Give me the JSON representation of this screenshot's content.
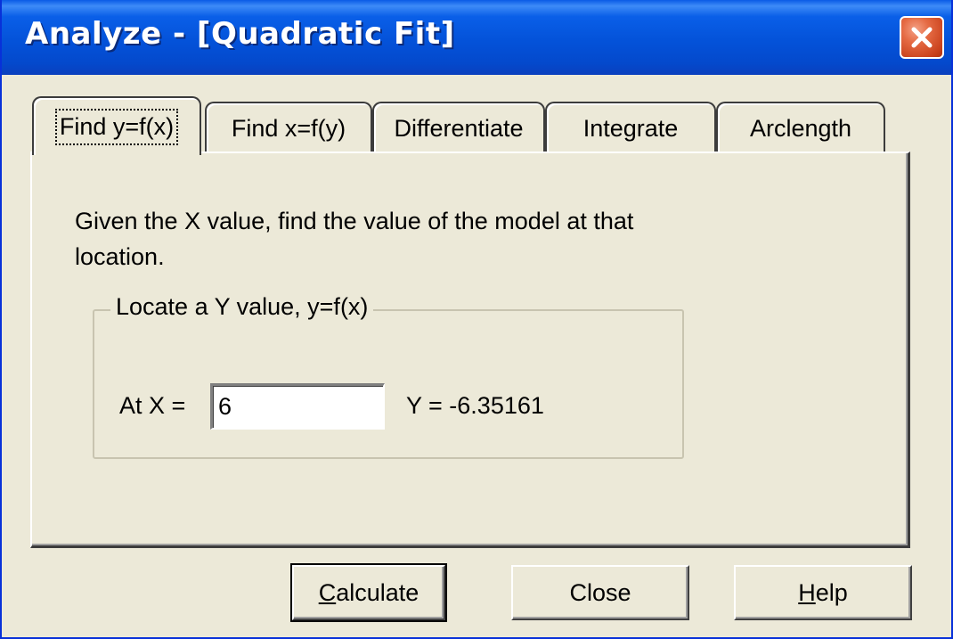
{
  "window": {
    "title": "Analyze - [Quadratic Fit]",
    "close_icon": "close-icon"
  },
  "tabs": [
    {
      "label": "Find y=f(x)",
      "active": true
    },
    {
      "label": "Find x=f(y)",
      "active": false
    },
    {
      "label": "Differentiate",
      "active": false
    },
    {
      "label": "Integrate",
      "active": false
    },
    {
      "label": "Arclength",
      "active": false
    }
  ],
  "panel": {
    "description": "Given the X value, find the value of the model at that location.",
    "group": {
      "legend": "Locate a Y value, y=f(x)",
      "x_label": "At X =",
      "x_value": "6",
      "y_result": "Y = -6.35161"
    }
  },
  "buttons": {
    "calculate": {
      "accel": "C",
      "rest": "alculate"
    },
    "close": "Close",
    "help": {
      "accel": "H",
      "rest": "elp"
    }
  },
  "colors": {
    "titlebar": "#0452d9",
    "close_button": "#e56a43",
    "dialog_face": "#ece9d8"
  }
}
